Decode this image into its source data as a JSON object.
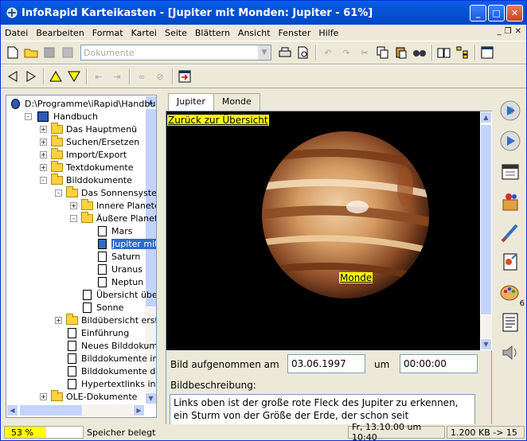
{
  "window": {
    "title": "InfoRapid Karteikasten - [Jupiter mit Monden: Jupiter - 61%]"
  },
  "menu": [
    "Datei",
    "Bearbeiten",
    "Format",
    "Kartei",
    "Seite",
    "Blättern",
    "Ansicht",
    "Fenster",
    "Hilfe"
  ],
  "toolbar": {
    "combo_placeholder": "Dokumente"
  },
  "tree": {
    "items": [
      {
        "label": "D:\\Programme\\iRapid\\Handbuch",
        "indent": 0,
        "type": "root"
      },
      {
        "label": "Handbuch",
        "indent": 1,
        "type": "book",
        "exp": "-"
      },
      {
        "label": "Das Hauptmenü",
        "indent": 2,
        "type": "folder",
        "exp": "+"
      },
      {
        "label": "Suchen/Ersetzen",
        "indent": 2,
        "type": "folder",
        "exp": "+"
      },
      {
        "label": "Import/Export",
        "indent": 2,
        "type": "folder",
        "exp": "+"
      },
      {
        "label": "Textdokumente",
        "indent": 2,
        "type": "folder",
        "exp": "+"
      },
      {
        "label": "Bilddokumente",
        "indent": 2,
        "type": "folder",
        "exp": "-"
      },
      {
        "label": "Das Sonnensystem",
        "indent": 3,
        "type": "folder",
        "exp": "-"
      },
      {
        "label": "Innere Planeten",
        "indent": 4,
        "type": "folder",
        "exp": "+"
      },
      {
        "label": "Äußere Planeten",
        "indent": 4,
        "type": "folder",
        "exp": "-"
      },
      {
        "label": "Mars",
        "indent": 5,
        "type": "doc"
      },
      {
        "label": "Jupiter mit",
        "indent": 5,
        "type": "doc",
        "selected": true
      },
      {
        "label": "Saturn",
        "indent": 5,
        "type": "doc"
      },
      {
        "label": "Uranus",
        "indent": 5,
        "type": "doc"
      },
      {
        "label": "Neptun",
        "indent": 5,
        "type": "doc"
      },
      {
        "label": "Übersicht übers",
        "indent": 4,
        "type": "doc"
      },
      {
        "label": "Sonne",
        "indent": 4,
        "type": "doc"
      },
      {
        "label": "Bildübersicht erste",
        "indent": 3,
        "type": "folder",
        "exp": "+"
      },
      {
        "label": "Einführung",
        "indent": 3,
        "type": "doc"
      },
      {
        "label": "Neues Bilddokument",
        "indent": 3,
        "type": "doc"
      },
      {
        "label": "Bilddokumente impo",
        "indent": 3,
        "type": "doc"
      },
      {
        "label": "Bilddokumente druc",
        "indent": 3,
        "type": "doc"
      },
      {
        "label": "Hypertextlinks in B",
        "indent": 3,
        "type": "doc"
      },
      {
        "label": "OLE-Dokumente",
        "indent": 2,
        "type": "folder",
        "exp": "+"
      }
    ]
  },
  "tabs": [
    "Jupiter",
    "Monde"
  ],
  "content": {
    "back_link": "Zurück zur Übersicht",
    "moons_link": "Monde",
    "taken_label": "Bild aufgenommen am",
    "date_value": "03.06.1997",
    "at_label": "um",
    "time_value": "00:00:00",
    "desc_label": "Bildbeschreibung:",
    "desc_text": "Links oben ist der große rote Fleck des Jupiter zu erkennen, ein Sturm von der Größe der Erde, der schon seit"
  },
  "rightbar": {
    "badge": "6"
  },
  "status": {
    "progress_percent": 53,
    "progress_label": "53 %",
    "memory_label": "Speicher belegt",
    "datetime": "Fr, 13.10.00 um 10:40",
    "size": "1.200 KB -> 15"
  },
  "colors": {
    "titlebar": "#0453d6",
    "link_bg": "#ffff00",
    "progress": "#ffff00"
  }
}
